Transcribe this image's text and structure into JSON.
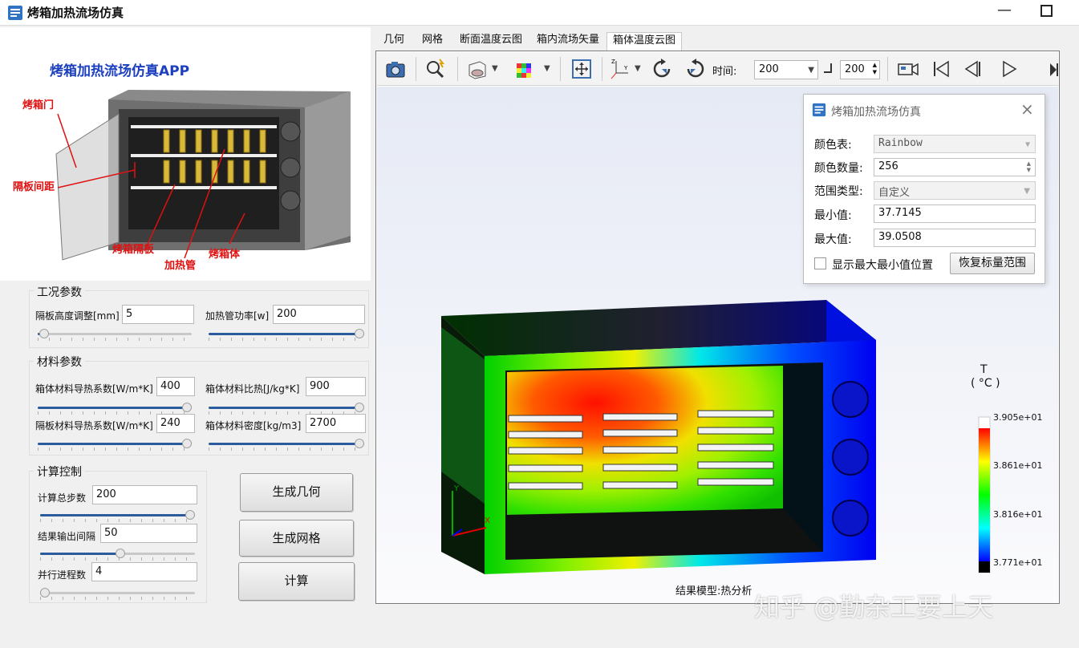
{
  "window": {
    "title": "烤箱加热流场仿真",
    "minimize": "—"
  },
  "illustration": {
    "title": "烤箱加热流场仿真APP",
    "labels": {
      "door": "烤箱门",
      "spacing": "隔板间距",
      "shelf": "烤箱隔板",
      "heater": "加热管",
      "body": "烤箱体"
    }
  },
  "conditions": {
    "title": "工况参数",
    "shelf_height_label": "隔板高度调整[mm]",
    "shelf_height_value": "5",
    "shelf_height_level": 0.04,
    "heater_power_label": "加热管功率[w]",
    "heater_power_value": "200",
    "heater_power_level": 1.0
  },
  "material": {
    "title": "材料参数",
    "body_conductivity_label": "箱体材料导热系数[W/m*K]",
    "body_conductivity_value": "400",
    "body_conductivity_level": 1.0,
    "body_specific_heat_label": "箱体材料比热[J/kg*K]",
    "body_specific_heat_value": "900",
    "body_specific_heat_level": 1.0,
    "shelf_conductivity_label": "隔板材料导热系数[W/m*K]",
    "shelf_conductivity_value": "240",
    "shelf_conductivity_level": 1.0,
    "body_density_label": "箱体材料密度[kg/m3]",
    "body_density_value": "2700",
    "body_density_level": 1.0
  },
  "compute": {
    "title": "计算控制",
    "total_steps_label": "计算总步数",
    "total_steps_value": "200",
    "total_steps_level": 1.0,
    "output_interval_label": "结果输出间隔",
    "output_interval_value": "50",
    "output_interval_level": 0.52,
    "processes_label": "并行进程数",
    "processes_value": "4",
    "processes_level": 0.03
  },
  "buttons": {
    "geometry": "生成几何",
    "mesh": "生成网格",
    "compute": "计算"
  },
  "tabs": [
    "几何",
    "网格",
    "断面温度云图",
    "箱内流场矢量",
    "箱体温度云图"
  ],
  "toolbar": {
    "time_label": "时间:",
    "time_value": "200",
    "step_value": "200"
  },
  "icons": [
    "camera-icon",
    "zoom-select-icon",
    "view-cube-icon",
    "color-cube-icon",
    "fit-view-icon",
    "axes-icon",
    "rotate-cw-icon",
    "rotate-ccw-icon",
    "video-icon",
    "first-frame-icon",
    "prev-frame-icon",
    "next-frame-icon",
    "last-frame-icon"
  ],
  "dialog": {
    "title": "烤箱加热流场仿真",
    "colormap_label": "颜色表:",
    "colormap_value": "Rainbow",
    "color_count_label": "颜色数量:",
    "color_count_value": "256",
    "range_type_label": "范围类型:",
    "range_type_value": "自定义",
    "min_label": "最小值:",
    "min_value": "37.7145",
    "max_label": "最大值:",
    "max_value": "39.0508",
    "show_minmax_label": "显示最大最小值位置",
    "reset_button": "恢复标量范围"
  },
  "legend": {
    "var": "T",
    "unit": "( °C )",
    "ticks": [
      "3.905e+01",
      "3.861e+01",
      "3.816e+01",
      "3.771e+01"
    ]
  },
  "axes": {
    "x": "X",
    "y": "Y"
  },
  "result_model_label": "结果模型:热分析",
  "watermark": "知乎 @勤杂工要上天",
  "colors": {
    "accent": "#2a5b9d",
    "red": "#ff0000",
    "blue": "#0000ff"
  }
}
